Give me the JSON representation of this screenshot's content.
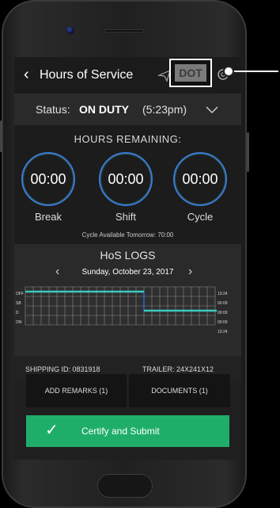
{
  "header": {
    "back_icon": "chevron-left-icon",
    "title": "Hours of Service",
    "send_icon": "send-icon",
    "dot_label": "DOT",
    "settings_icon": "gear-icon"
  },
  "status": {
    "label": "Status:",
    "value": "ON DUTY",
    "time": "(5:23pm)",
    "dropdown_icon": "chevron-down-icon"
  },
  "hours": {
    "title": "HOURS REMAINING:",
    "timers": [
      {
        "value": "00:00",
        "label": "Break"
      },
      {
        "value": "00:00",
        "label": "Shift"
      },
      {
        "value": "00:00",
        "label": "Cycle"
      }
    ],
    "note": "Cycle Available Tomorrow: 70:00",
    "ring_color": "#3a7bd5"
  },
  "logs": {
    "title": "HoS LOGS",
    "date": "Sunday, October 23, 2017",
    "rows": [
      "OFF",
      "SB",
      "D",
      "ON"
    ],
    "totals": [
      "13:24",
      "00:00",
      "00:00",
      "00:00",
      "13:24"
    ],
    "line_color": "#3cc8c0",
    "step_color": "#2a6fd8"
  },
  "shipping": {
    "id": "SHIPPING ID: 0831918",
    "trailer": "TRAILER:  24X241X12"
  },
  "actions": {
    "remarks": "ADD REMARKS (1)",
    "documents": "DOCUMENTS (1)"
  },
  "certify": {
    "label": "Certify and Submit",
    "check_icon": "check-icon",
    "color": "#1fae6a"
  }
}
